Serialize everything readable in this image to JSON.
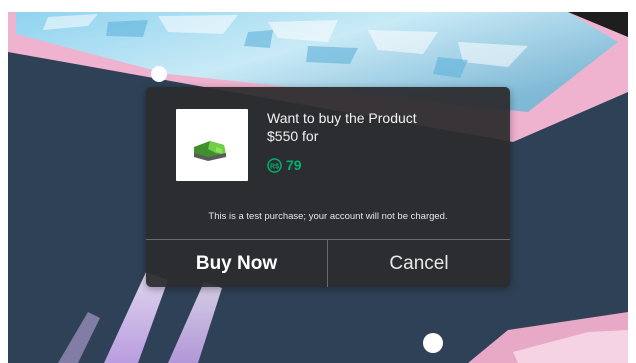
{
  "dialog": {
    "prompt_line1": "Want to buy the Product",
    "prompt_line2": "$550 for",
    "price": "79",
    "disclaimer": "This is a test purchase; your account will not be charged.",
    "buy_label": "Buy Now",
    "cancel_label": "Cancel"
  },
  "icons": {
    "product": "product-thumbnail-icon",
    "currency": "robux-icon"
  },
  "colors": {
    "dialog_bg": "#2c2c2e",
    "price_green": "#00b06f",
    "scene_bg": "#304257"
  }
}
